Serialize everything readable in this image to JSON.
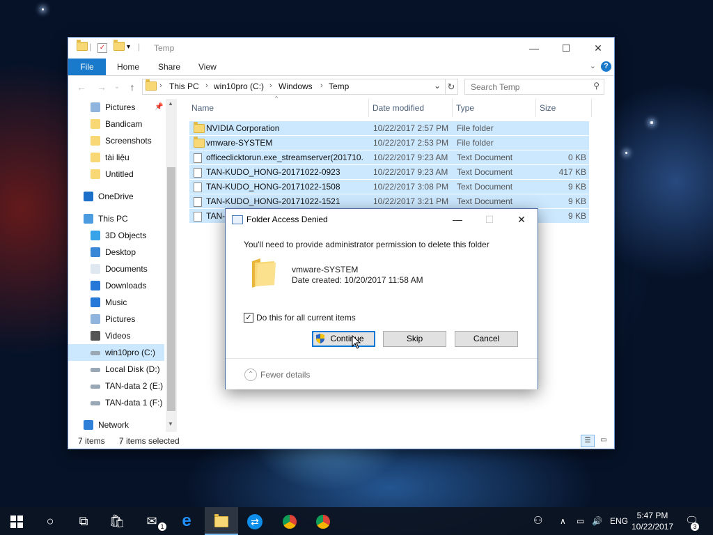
{
  "window": {
    "title": "Temp",
    "ribbon_tabs": [
      "File",
      "Home",
      "Share",
      "View"
    ],
    "address": {
      "crumbs": [
        "This PC",
        "win10pro (C:)",
        "Windows",
        "Temp"
      ]
    },
    "search_placeholder": "Search Temp"
  },
  "nav": {
    "items": [
      {
        "label": "Pictures",
        "icon": "pictures-icon"
      },
      {
        "label": "Bandicam",
        "icon": "folder-icon"
      },
      {
        "label": "Screenshots",
        "icon": "folder-icon"
      },
      {
        "label": "tài liệu",
        "icon": "folder-icon"
      },
      {
        "label": "Untitled",
        "icon": "folder-icon"
      },
      {
        "label": "OneDrive",
        "icon": "onedrive-icon"
      },
      {
        "label": "This PC",
        "icon": "pc-icon"
      },
      {
        "label": "3D Objects",
        "icon": "3d-objects-icon"
      },
      {
        "label": "Desktop",
        "icon": "desktop-icon"
      },
      {
        "label": "Documents",
        "icon": "documents-icon"
      },
      {
        "label": "Downloads",
        "icon": "downloads-icon"
      },
      {
        "label": "Music",
        "icon": "music-icon"
      },
      {
        "label": "Pictures",
        "icon": "pictures-icon"
      },
      {
        "label": "Videos",
        "icon": "videos-icon"
      },
      {
        "label": "win10pro (C:)",
        "icon": "drive-icon"
      },
      {
        "label": "Local Disk (D:)",
        "icon": "drive-icon"
      },
      {
        "label": "TAN-data 2 (E:)",
        "icon": "drive-icon"
      },
      {
        "label": "TAN-data 1 (F:)",
        "icon": "drive-icon"
      },
      {
        "label": "Network",
        "icon": "network-icon"
      }
    ]
  },
  "columns": {
    "name": "Name",
    "date": "Date modified",
    "type": "Type",
    "size": "Size"
  },
  "files": [
    {
      "name": "NVIDIA Corporation",
      "date": "10/22/2017 2:57 PM",
      "type": "File folder",
      "size": ""
    },
    {
      "name": "vmware-SYSTEM",
      "date": "10/22/2017 2:53 PM",
      "type": "File folder",
      "size": ""
    },
    {
      "name": "officeclicktorun.exe_streamserver(201710...",
      "date": "10/22/2017 9:23 AM",
      "type": "Text Document",
      "size": "0 KB"
    },
    {
      "name": "TAN-KUDO_HONG-20171022-0923",
      "date": "10/22/2017 9:23 AM",
      "type": "Text Document",
      "size": "417 KB"
    },
    {
      "name": "TAN-KUDO_HONG-20171022-1508",
      "date": "10/22/2017 3:08 PM",
      "type": "Text Document",
      "size": "9 KB"
    },
    {
      "name": "TAN-KUDO_HONG-20171022-1521",
      "date": "10/22/2017 3:21 PM",
      "type": "Text Document",
      "size": "9 KB"
    },
    {
      "name": "TAN-",
      "date": "",
      "type": "",
      "size": "9 KB"
    }
  ],
  "status": {
    "count": "7 items",
    "selected": "7 items selected"
  },
  "dialog": {
    "title": "Folder Access Denied",
    "message": "You'll need to provide administrator permission to delete this folder",
    "folder_name": "vmware-SYSTEM",
    "date_created": "Date created: 10/20/2017 11:58 AM",
    "checkbox_label": "Do this for all current items",
    "checkbox_mark": "✓",
    "buttons": {
      "continue": "Continue",
      "skip": "Skip",
      "cancel": "Cancel"
    },
    "details_toggle": "Fewer details"
  },
  "taskbar": {
    "language": "ENG",
    "time": "5:47 PM",
    "date": "10/22/2017",
    "mail_badge": "1",
    "notification_badge": "3"
  }
}
